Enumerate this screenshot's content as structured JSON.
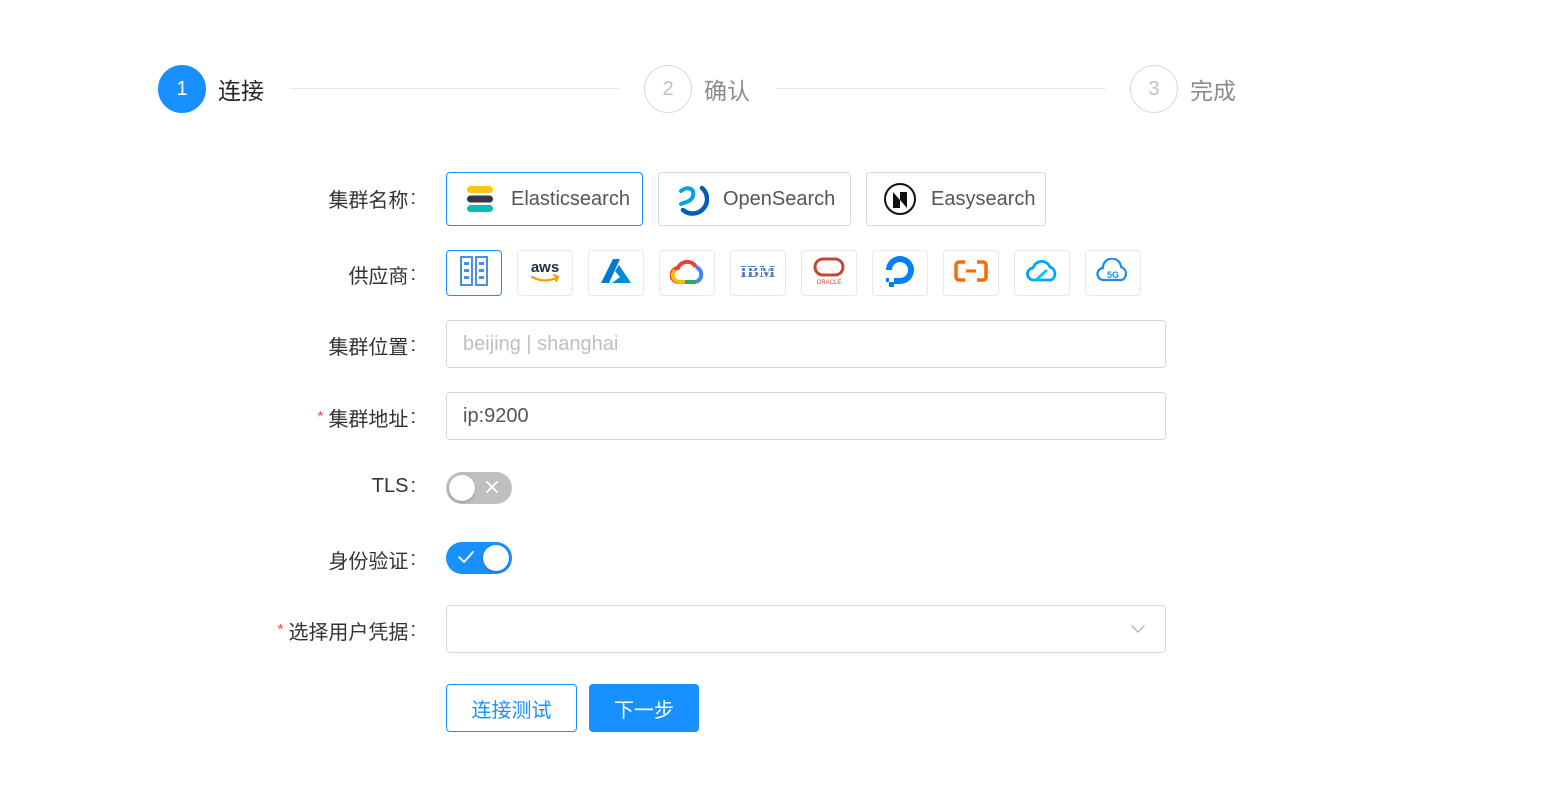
{
  "steps": [
    {
      "number": "1",
      "title": "连接",
      "state": "active"
    },
    {
      "number": "2",
      "title": "确认",
      "state": "wait"
    },
    {
      "number": "3",
      "title": "完成",
      "state": "wait"
    }
  ],
  "form": {
    "cluster_name": {
      "label": "集群名称",
      "options": [
        "Elasticsearch",
        "OpenSearch",
        "Easysearch"
      ],
      "selected": "Elasticsearch"
    },
    "provider": {
      "label": "供应商",
      "options": [
        "on-premise-icon",
        "aws-icon",
        "azure-icon",
        "google-cloud-icon",
        "ibm-icon",
        "oracle-icon",
        "digitalocean-icon",
        "alibaba-cloud-icon",
        "tencent-cloud-icon",
        "5g-cloud-icon"
      ],
      "selected": "on-premise-icon",
      "ibm_text": "IBM",
      "oracle_text": "ORACLE",
      "fiveg_text": "5G"
    },
    "location": {
      "label": "集群位置",
      "placeholder": "beijing | shanghai"
    },
    "address": {
      "label": "集群地址",
      "required": true,
      "value": "ip:9200"
    },
    "tls": {
      "label": "TLS",
      "enabled": false
    },
    "auth": {
      "label": "身份验证",
      "enabled": true
    },
    "credential": {
      "label": "选择用户凭据",
      "required": true,
      "value": ""
    },
    "required_mark": "*",
    "colon": ":"
  },
  "actions": {
    "test_label": "连接测试",
    "next_label": "下一步"
  },
  "colors": {
    "primary": "#1890ff",
    "required": "#ff4d4f",
    "border": "#d9d9d9"
  }
}
